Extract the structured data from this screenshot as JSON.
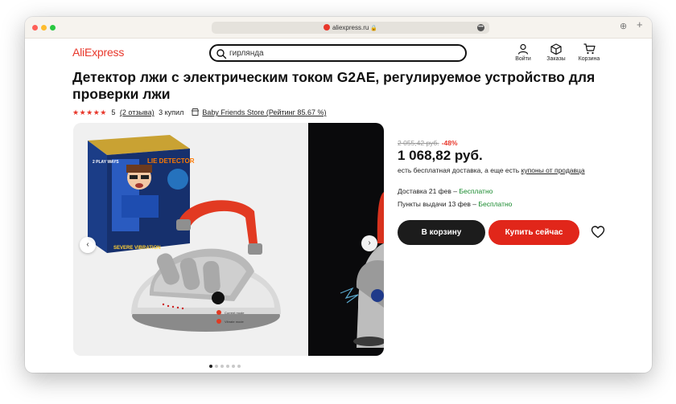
{
  "browser": {
    "url": "aliexpress.ru",
    "lock_glyph": "🔒",
    "more_glyph": "•••",
    "download_glyph": "⊕",
    "newtab_glyph": "+"
  },
  "header": {
    "logo": "AliExpress",
    "search": {
      "value": "гирлянда",
      "placeholder": ""
    },
    "login": "Войти",
    "orders": "Заказы",
    "cart": "Корзина"
  },
  "product": {
    "title": "Детектор лжи с электрическим током G2AE, регулируемое устройство для проверки лжи",
    "stars": "★★★★★",
    "rating": "5",
    "reviews": "(2 отзыва)",
    "bought": "3 купил",
    "store": "Baby Friends Store (Рейтинг 85.67 %)"
  },
  "gallery": {
    "prev_glyph": "‹",
    "next_glyph": "›",
    "slide_count": 6,
    "active_slide": 1,
    "box_text_1": "LIE DETECTOR",
    "box_text_2": "SEVERE VIBRATION",
    "box_text_3": "2 PLAY WAYS",
    "panel_text_1": "Current mode",
    "panel_text_2": "Vibrate mode"
  },
  "pricing": {
    "old_price": "2 055,42 руб.",
    "discount": "-48%",
    "price": "1 068,82 руб.",
    "delivery_note_prefix": "есть бесплатная доставка, а еще есть",
    "delivery_note_link": "купоны от продавца"
  },
  "shipping": {
    "delivery_label": "Доставка 21 фев –",
    "delivery_value": "Бесплатно",
    "pickup_label": "Пункты выдачи 13 фев –",
    "pickup_value": "Бесплатно"
  },
  "actions": {
    "add_to_cart": "В корзину",
    "buy_now": "Купить сейчас"
  },
  "colors": {
    "brand_red": "#e8372b",
    "buy_button": "#e1261a",
    "cart_button": "#1c1c1c",
    "free_green": "#188a2e"
  }
}
